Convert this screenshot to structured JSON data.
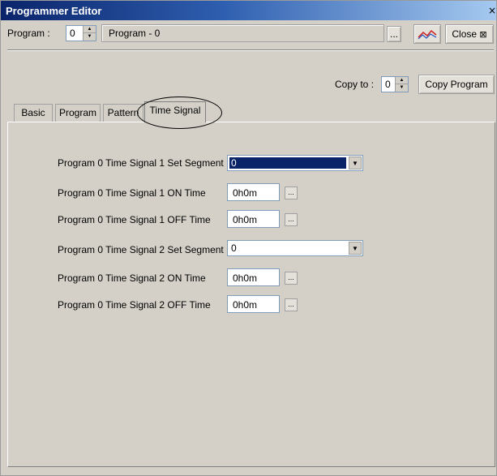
{
  "window": {
    "title": "Programmer Editor",
    "close_glyph": "×"
  },
  "header": {
    "program_label": "Program :",
    "program_number": "0",
    "program_name": "Program - 0",
    "browse_label": "...",
    "graph_icon": "trend-graph-icon",
    "close_label": "Close",
    "close_icon_glyph": "⊠"
  },
  "copy": {
    "label": "Copy to :",
    "value": "0",
    "button_label": "Copy Program"
  },
  "tabs": [
    {
      "label": "Basic"
    },
    {
      "label": "Program"
    },
    {
      "label": "Pattern"
    },
    {
      "label": "Time Signal"
    }
  ],
  "active_tab": "Time Signal",
  "rows": [
    {
      "label": "Program 0 Time Signal 1 Set Segment",
      "value": "0",
      "type": "combo",
      "selected": true
    },
    {
      "label": "Program 0 Time Signal 1 ON Time",
      "value": "0h0m",
      "type": "time"
    },
    {
      "label": "Program 0 Time Signal 1 OFF Time",
      "value": "0h0m",
      "type": "time"
    },
    {
      "label": "Program 0 Time Signal 2 Set Segment",
      "value": "0",
      "type": "combo",
      "selected": false
    },
    {
      "label": "Program 0 Time Signal 2 ON Time",
      "value": "0h0m",
      "type": "time"
    },
    {
      "label": "Program 0 Time Signal 2 OFF Time",
      "value": "0h0m",
      "type": "time"
    }
  ],
  "small_button_label": "...",
  "colors": {
    "window_bg": "#d4d0c8",
    "title_dark": "#0a246a",
    "selection": "#0a246a"
  }
}
